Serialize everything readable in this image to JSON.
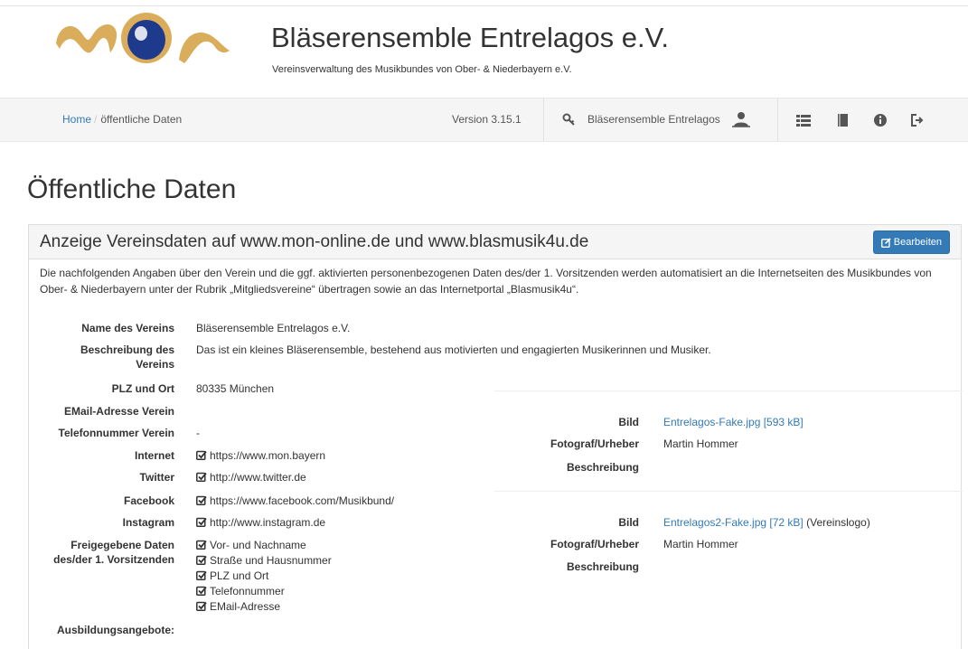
{
  "header": {
    "logo_text": "mon",
    "title": "Bläserensemble Entrelagos e.V.",
    "subtitle": "Vereinsverwaltung des Musikbundes von Ober- & Niederbayern e.V."
  },
  "nav": {
    "breadcrumb": [
      {
        "label": "Home"
      },
      {
        "label": "öffentliche Daten"
      }
    ],
    "breadcrumb_sep": "/",
    "version": "Version 3.15.1",
    "club_name": "Bläserensemble Entrelagos",
    "icons": [
      "key-icon",
      "user-switch-icon",
      "list-icon",
      "book-icon",
      "info-icon",
      "logout-icon"
    ]
  },
  "page_title": "Öffentliche Daten",
  "panel": {
    "title": "Anzeige Vereinsdaten auf www.mon-online.de und www.blasmusik4u.de",
    "edit_label": "Bearbeiten",
    "intro": "Die nachfolgenden Angaben über den Verein und die ggf. aktivierten personenbezogenen Daten des/der 1. Vorsitzenden werden automatisiert an die Internetseiten des Musikbundes von Ober- & Niederbayern unter der Rubrik „Mitgliedsvereine“ übertragen sowie an das Internetportal „Blasmusik4u“."
  },
  "fields": {
    "name_label": "Name des Vereins",
    "name_value": "Bläserensemble Entrelagos e.V.",
    "desc_label_1": "Beschreibung des",
    "desc_label_2": "Vereins",
    "desc_value": "Das ist ein kleines Bläserensemble, bestehend aus motivierten und engagierten Musikerinnen und Musiker.",
    "plz_label": "PLZ und Ort",
    "plz_value": "80335 München",
    "email_label": "EMail-Adresse Verein",
    "email_value": "",
    "phone_label": "Telefonnummer Verein",
    "phone_value": "-",
    "internet_label": "Internet",
    "internet_value": "https://www.mon.bayern",
    "twitter_label": "Twitter",
    "twitter_value": "http://www.twitter.de",
    "facebook_label": "Facebook",
    "facebook_value": "https://www.facebook.com/Musikbund/",
    "instagram_label": "Instagram",
    "instagram_value": "http://www.instagram.de",
    "released_label_1": "Freigegebene Daten",
    "released_label_2": "des/der 1. Vorsitzenden",
    "released_items": [
      "Vor- und Nachname",
      "Straße und Hausnummer",
      "PLZ und Ort",
      "Telefonnummer",
      "EMail-Adresse"
    ],
    "training_label": "Ausbildungsangebote:"
  },
  "images": [
    {
      "bild_label": "Bild",
      "file": "Entrelagos-Fake.jpg [593 kB]",
      "note": "",
      "photographer_label": "Fotograf/Urheber",
      "photographer": "Martin Hommer",
      "desc_label": "Beschreibung"
    },
    {
      "bild_label": "Bild",
      "file": "Entrelagos2-Fake.jpg [72 kB]",
      "note": "(Vereinslogo)",
      "photographer_label": "Fotograf/Urheber",
      "photographer": "Martin Hommer",
      "desc_label": "Beschreibung"
    }
  ],
  "colors": {
    "link": "#337ab7",
    "button": "#337ab7",
    "logo_gold": "#d9ad5c",
    "logo_blue": "#1d3a8c"
  }
}
